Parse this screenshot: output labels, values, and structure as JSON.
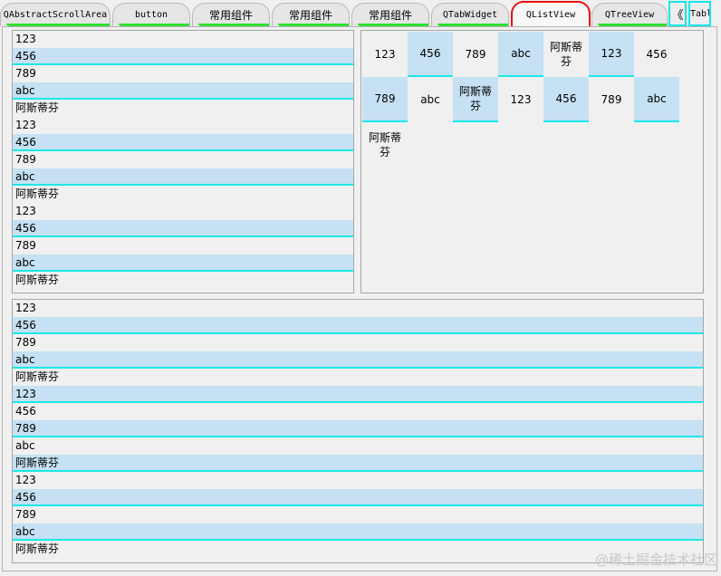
{
  "tabs": [
    {
      "label": "QAbstractScrollArea",
      "active": false
    },
    {
      "label": "button",
      "active": false
    },
    {
      "label": "常用组件",
      "active": false
    },
    {
      "label": "常用组件",
      "active": false
    },
    {
      "label": "常用组件",
      "active": false
    },
    {
      "label": "QTabWidget",
      "active": false
    },
    {
      "label": "QListView",
      "active": true
    },
    {
      "label": "QTreeView",
      "active": false
    },
    {
      "label": "Table",
      "active": false
    }
  ],
  "tab_scroll": {
    "left_label": "《",
    "right_label": "〉"
  },
  "list_left": [
    "123",
    "456",
    "789",
    "abc",
    "阿斯蒂芬",
    "123",
    "456",
    "789",
    "abc",
    "阿斯蒂芬",
    "123",
    "456",
    "789",
    "abc",
    "阿斯蒂芬"
  ],
  "list_left_selected": [
    1,
    3,
    6,
    8,
    11,
    13
  ],
  "icon_view": [
    "123",
    "456",
    "789",
    "abc",
    "阿斯蒂芬",
    "123",
    "456",
    "789",
    "abc",
    "阿斯蒂芬",
    "123",
    "456",
    "789",
    "abc",
    "阿斯蒂芬"
  ],
  "icon_view_selected": [
    1,
    3,
    5,
    7,
    9,
    11,
    13
  ],
  "list_bottom": [
    "123",
    "456",
    "789",
    "abc",
    "阿斯蒂芬",
    "123",
    "456",
    "789",
    "abc",
    "阿斯蒂芬",
    "123",
    "456",
    "789",
    "abc",
    "阿斯蒂芬"
  ],
  "list_bottom_selected": [
    1,
    3,
    5,
    7,
    9,
    11,
    13
  ],
  "colors": {
    "selection": "#c5e1f3",
    "selection_underline": "#1ce8e8",
    "active_tab_border": "#e81010",
    "tab_underline": "#2fe02f"
  },
  "watermark": "@稀土掘金技术社区"
}
